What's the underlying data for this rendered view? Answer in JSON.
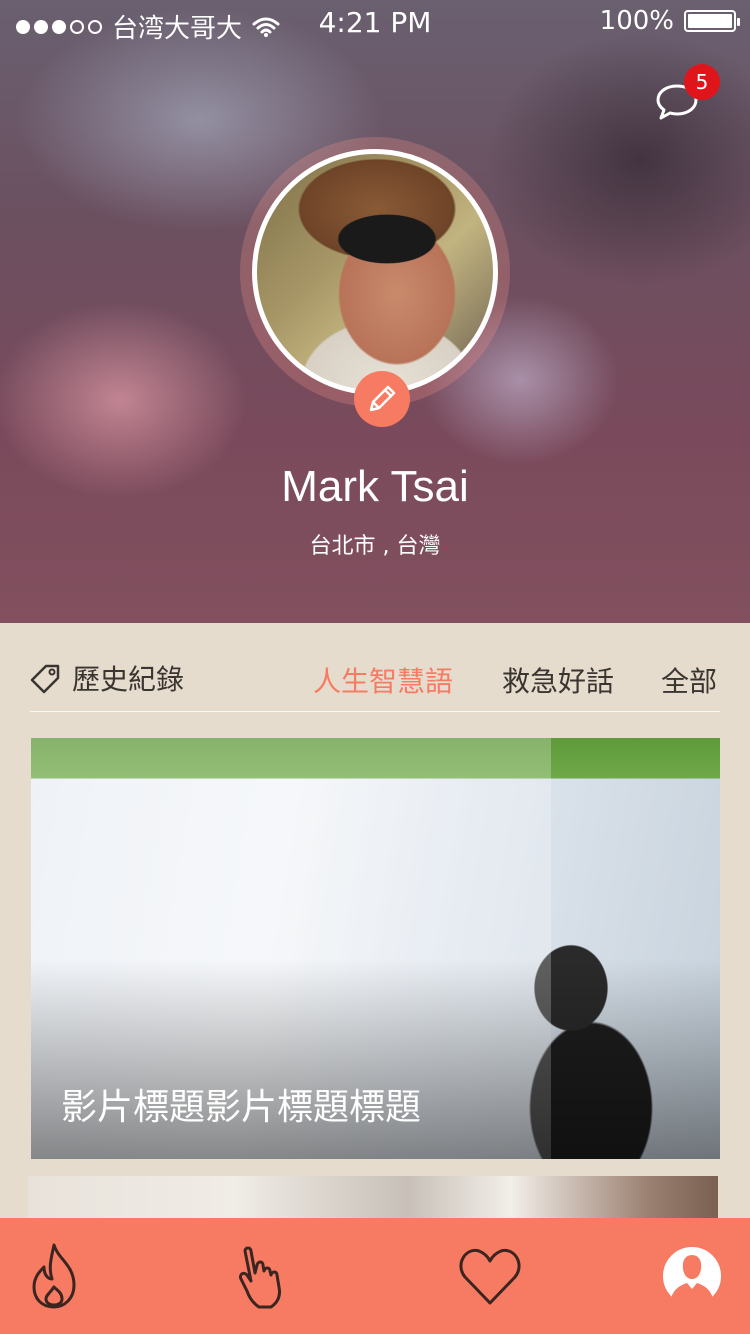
{
  "status_bar": {
    "carrier": "台湾大哥大",
    "time": "4:21 PM",
    "battery": "100%"
  },
  "header": {
    "messages_badge": "5"
  },
  "profile": {
    "name": "Mark Tsai",
    "location": "台北市 , 台灣"
  },
  "tabs": {
    "history_label": "歷史紀錄",
    "items": [
      {
        "label": "人生智慧語",
        "active": true
      },
      {
        "label": "救急好話",
        "active": false
      },
      {
        "label": "全部",
        "active": false
      }
    ]
  },
  "cards": [
    {
      "title": "影片標題影片標題標題"
    }
  ],
  "bottom_nav": {
    "items": [
      "fire-icon",
      "hand-pointer-icon",
      "heart-icon",
      "profile-icon"
    ],
    "active": "profile-icon"
  },
  "colors": {
    "accent": "#f77a62",
    "badge": "#e0151b",
    "background": "#e6dccd"
  }
}
